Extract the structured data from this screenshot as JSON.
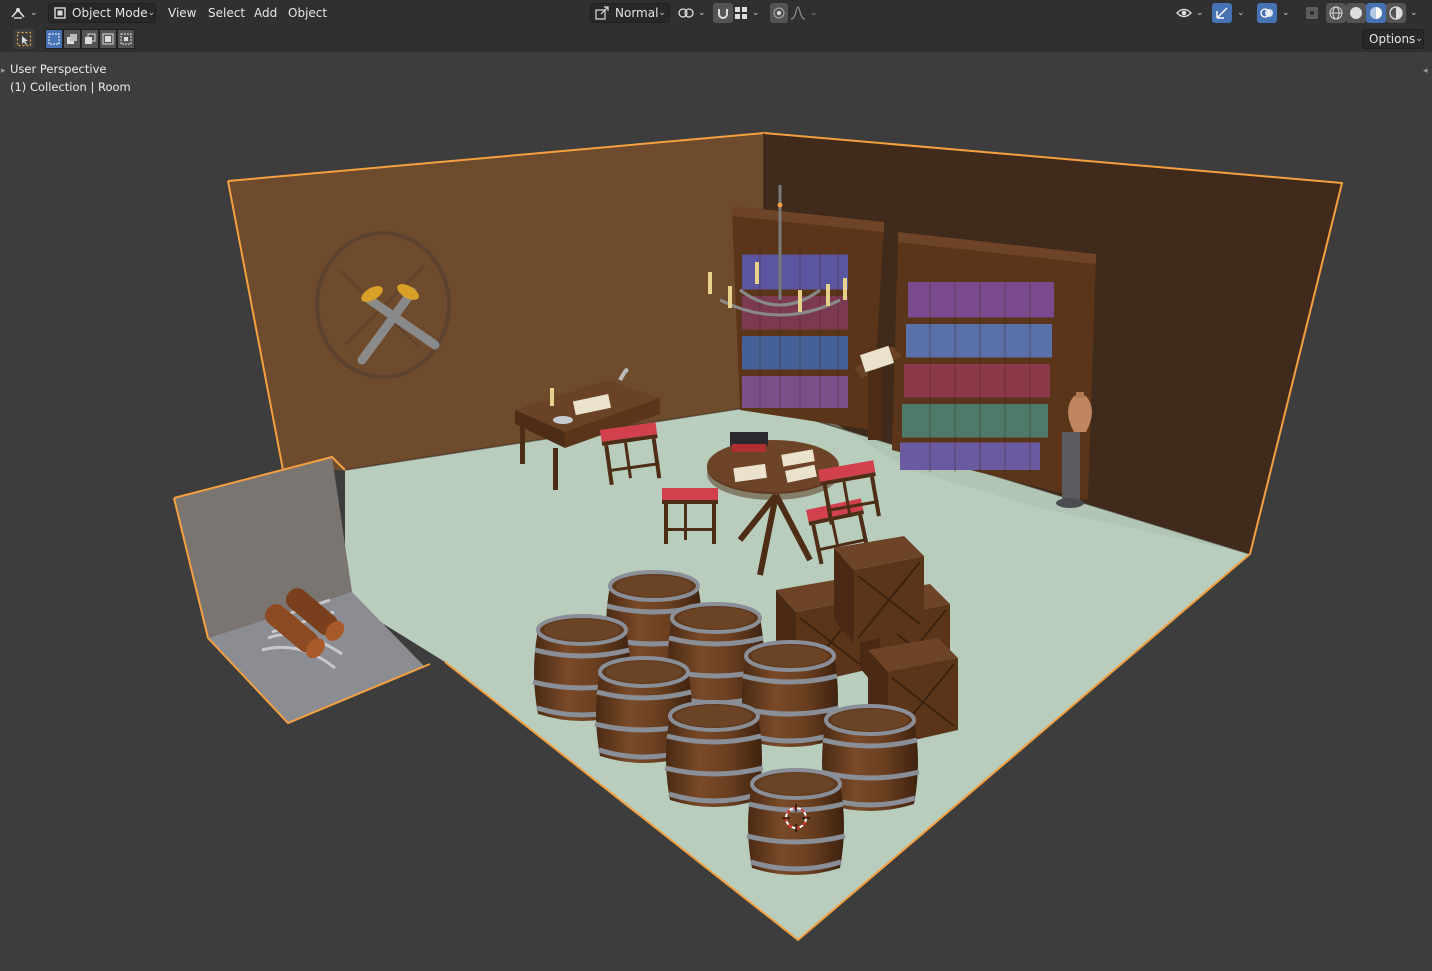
{
  "header": {
    "editor_type_icon": "editor-type-icon",
    "mode_label": "Object Mode",
    "menus": [
      "View",
      "Select",
      "Add",
      "Object"
    ],
    "transform_orientation": "Normal"
  },
  "toolbar": {
    "options_label": "Options"
  },
  "viewport": {
    "perspective_label": "User Perspective",
    "collection_label": "(1) Collection | Room"
  },
  "colors": {
    "header_bg": "#303030",
    "viewport_bg": "#3d3d3d",
    "accent_blue": "#4772b3",
    "selection_orange": "#f5a040",
    "wall_left": "#6e4a2d",
    "wall_right": "#3e2a1c",
    "floor": "#b7ccbb",
    "wood": "#6a3f22"
  }
}
